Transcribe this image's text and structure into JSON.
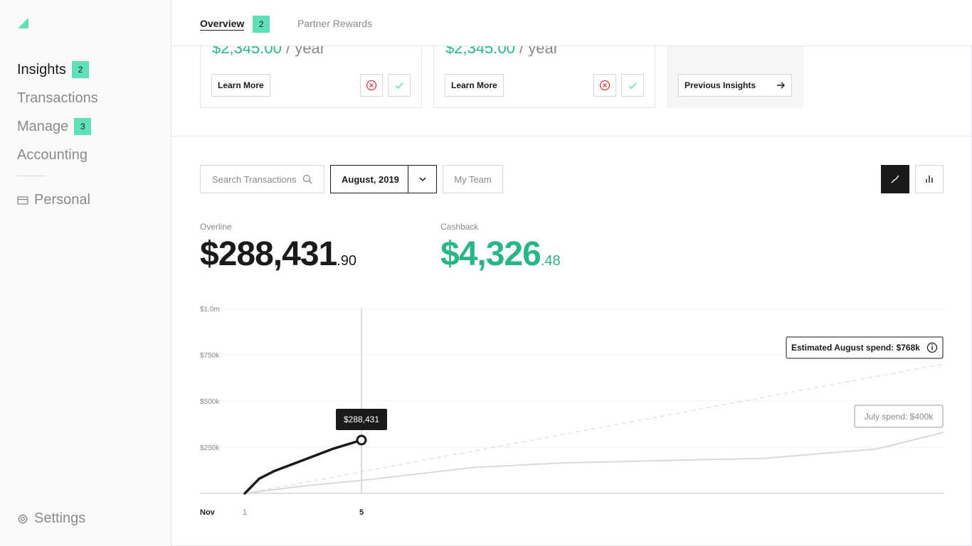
{
  "sidebar": {
    "items": [
      {
        "label": "Insights",
        "badge": "2",
        "active": true
      },
      {
        "label": "Transactions",
        "badge": "",
        "active": false
      },
      {
        "label": "Manage",
        "badge": "3",
        "active": false
      },
      {
        "label": "Accounting",
        "badge": "",
        "active": false
      }
    ],
    "personal_label": "Personal",
    "settings_label": "Settings"
  },
  "topnav": {
    "overview_label": "Overview",
    "overview_badge": "2",
    "partner_label": "Partner Rewards"
  },
  "cards": [
    {
      "price": "$2,345.00",
      "period": "/ year",
      "button": "Learn More"
    },
    {
      "price": "$2,345.00",
      "period": "/ year",
      "button": "Learn More"
    }
  ],
  "previous_insights_label": "Previous Insights",
  "filters": {
    "search_placeholder": "Search Transactions",
    "date_value": "August, 2019",
    "team_label": "My Team"
  },
  "stats": {
    "overline_label": "Overline",
    "overline_dollars": "$288,431",
    "overline_cents": ".90",
    "cashback_label": "Cashback",
    "cashback_dollars": "$4,326",
    "cashback_cents": ".48"
  },
  "colors": {
    "accent": "#5fe0b8",
    "money_green": "#2ab589",
    "dark": "#1a1a1a",
    "reject_red": "#e03a3a"
  },
  "chart_data": {
    "type": "line",
    "ylim": [
      0,
      1000000
    ],
    "y_ticks": [
      {
        "value": 1000000,
        "label": "$1.0m"
      },
      {
        "value": 750000,
        "label": "$750k"
      },
      {
        "value": 500000,
        "label": "$500k"
      },
      {
        "value": 250000,
        "label": "$250k"
      }
    ],
    "x_ticks": [
      {
        "value": 1,
        "label": "1"
      },
      {
        "value": 5,
        "label": "5"
      }
    ],
    "month_label": "Nov",
    "xlim": [
      0,
      31
    ],
    "series": [
      {
        "values": [
          [
            1,
            0
          ],
          [
            1.5,
            80000
          ],
          [
            2,
            120000
          ],
          [
            3,
            180000
          ],
          [
            4,
            240000
          ],
          [
            5,
            288431
          ]
        ]
      },
      {
        "values": [
          [
            1,
            0
          ],
          [
            3,
            40000
          ],
          [
            5,
            70000
          ],
          [
            10,
            140000
          ],
          [
            14,
            165000
          ],
          [
            23,
            190000
          ],
          [
            28,
            240000
          ],
          [
            31,
            330000
          ]
        ]
      },
      {
        "values": [
          [
            1,
            0
          ],
          [
            31,
            700000
          ]
        ]
      }
    ],
    "current_marker": {
      "x": 5,
      "y": 288431,
      "label": "$288,431"
    },
    "annotations": [
      {
        "label": "Estimated August spend: $768k"
      },
      {
        "label": "July spend: $400k"
      }
    ]
  }
}
